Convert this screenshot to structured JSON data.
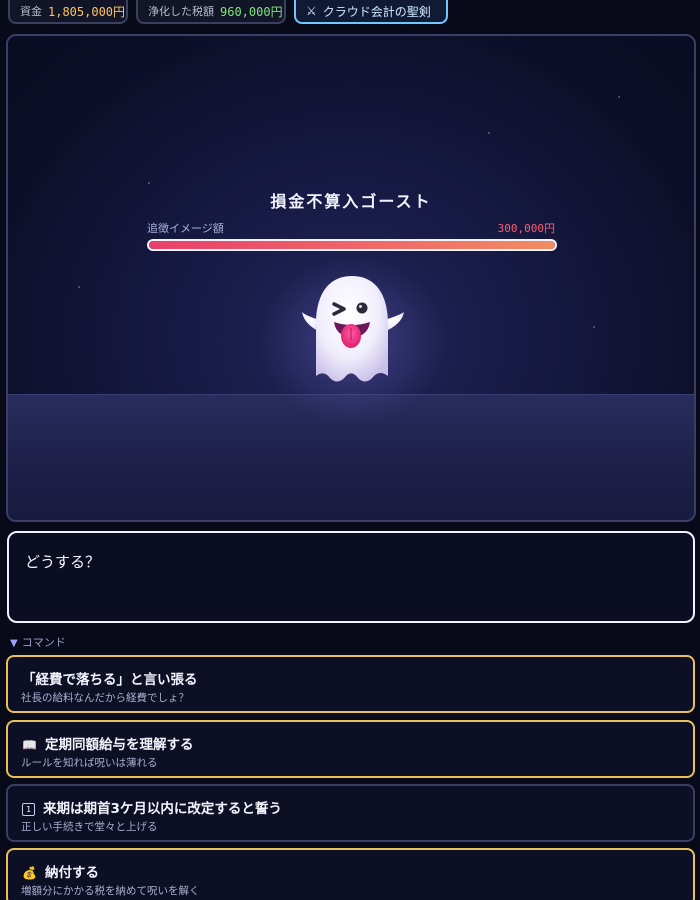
{
  "status": {
    "funds_label": "資金",
    "funds_value": "1,805,000円",
    "purified_label": "浄化した税額",
    "purified_value": "960,000円",
    "item_icon": "crossed-swords-icon",
    "item_name": "クラウド会計の聖剣"
  },
  "battle": {
    "enemy_name": "損金不算入ゴースト",
    "hp_label": "追徴イメージ額",
    "hp_value": "300,000円",
    "hp_fill_percent": 100,
    "enemy_icon": "ghost-winking-tongue-icon"
  },
  "dialog": {
    "text": "どうする？"
  },
  "commands": {
    "header": "コマンド",
    "items": [
      {
        "icon": "",
        "title": "「経費で落ちる」と言い張る",
        "subtitle": "社長の給料なんだから経費でしょ？"
      },
      {
        "icon": "📖",
        "title": "定期同額給与を理解する",
        "subtitle": "ルールを知れば呪いは薄れる"
      },
      {
        "icon": "1",
        "title": "来期は期首3ケ月以内に改定すると誓う",
        "subtitle": "正しい手続きで堂々と上げる"
      },
      {
        "icon": "💰",
        "title": "納付する",
        "subtitle": "増額分にかかる税を納めて呪いを解く"
      }
    ]
  },
  "colors": {
    "accent_gold": "#e8c05a",
    "funds": "#ffc658",
    "purified": "#7de87a",
    "hp": "#ff5c6c",
    "item_border": "#6ec8ff"
  }
}
